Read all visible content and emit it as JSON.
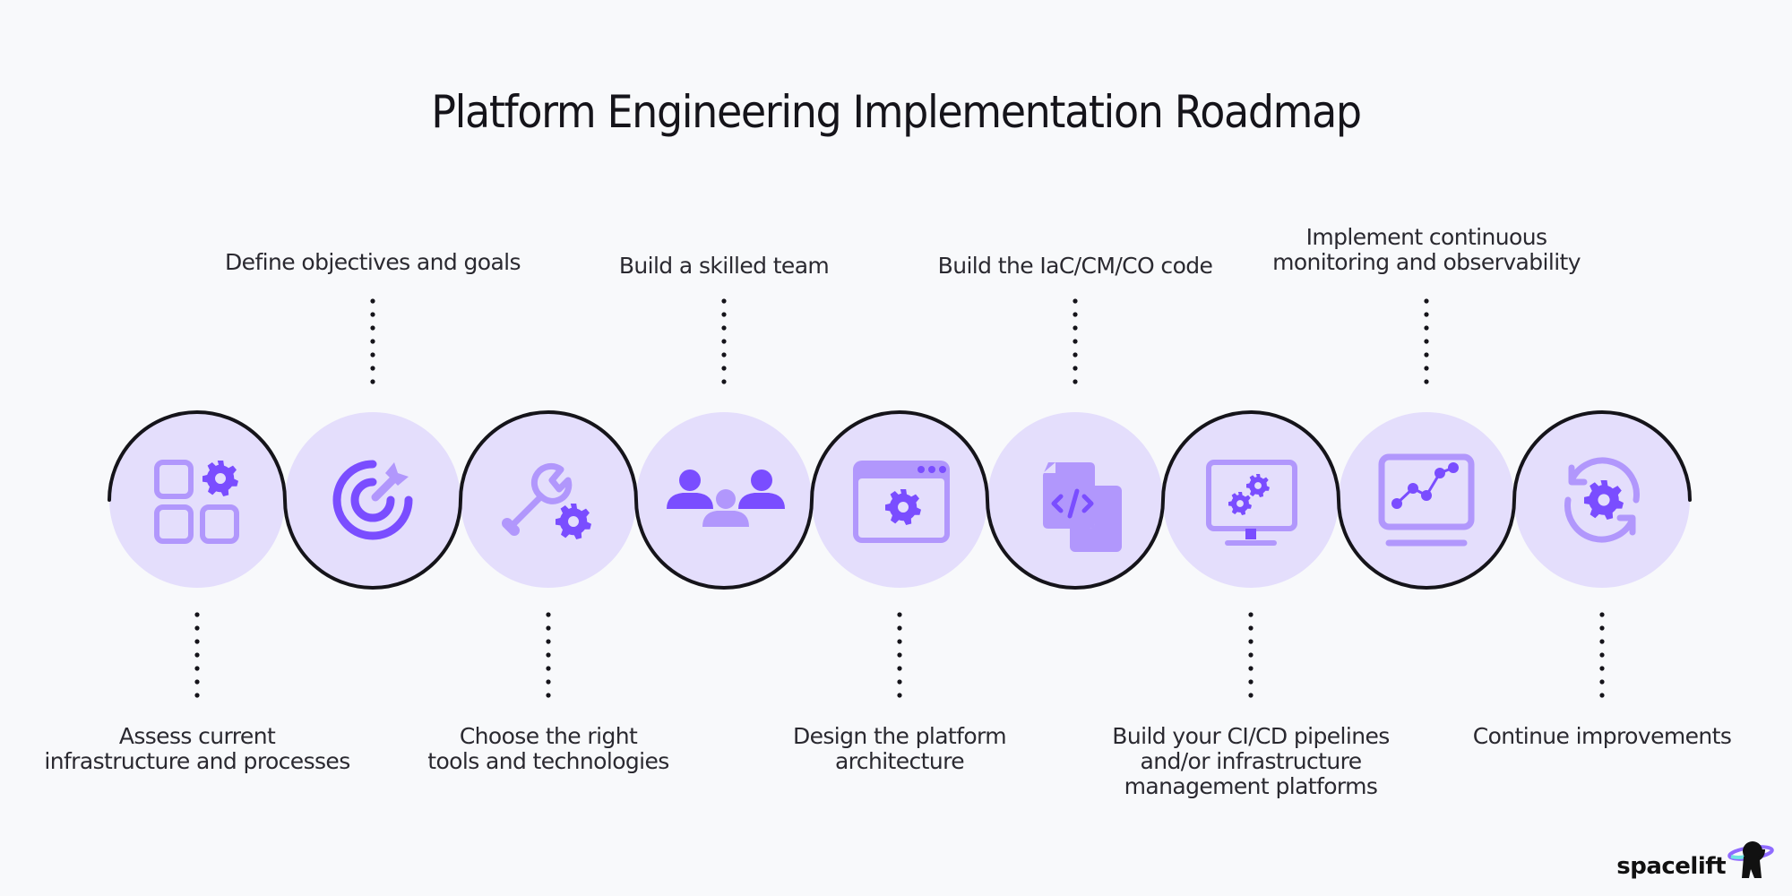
{
  "title": "Platform Engineering Implementation Roadmap",
  "colors": {
    "background": "#f8f9fb",
    "circle_fill": "#e4defc",
    "icon_light": "#b197fc",
    "icon_dark": "#7a4dff",
    "line": "#15141a"
  },
  "steps": [
    {
      "step": 1,
      "label": "Assess current\ninfrastructure and processes",
      "position": "bottom",
      "icon": "grid-gear-icon"
    },
    {
      "step": 2,
      "label": "Define objectives and goals",
      "position": "top",
      "icon": "target-icon"
    },
    {
      "step": 3,
      "label": "Choose the right\ntools and technologies",
      "position": "bottom",
      "icon": "wrench-gear-icon"
    },
    {
      "step": 4,
      "label": "Build a skilled team",
      "position": "top",
      "icon": "team-icon"
    },
    {
      "step": 5,
      "label": "Design the platform\narchitecture",
      "position": "bottom",
      "icon": "browser-gear-icon"
    },
    {
      "step": 6,
      "label": "Build the IaC/CM/CO code",
      "position": "top",
      "icon": "code-files-icon"
    },
    {
      "step": 7,
      "label": "Build your CI/CD pipelines\nand/or infrastructure\nmanagement platforms",
      "position": "bottom",
      "icon": "monitor-gears-icon"
    },
    {
      "step": 8,
      "label": "Implement continuous\nmonitoring and observability",
      "position": "top",
      "icon": "monitor-chart-icon"
    },
    {
      "step": 9,
      "label": "Continue improvements",
      "position": "bottom",
      "icon": "refresh-gear-icon"
    }
  ],
  "logo": {
    "text": "spacelift"
  }
}
